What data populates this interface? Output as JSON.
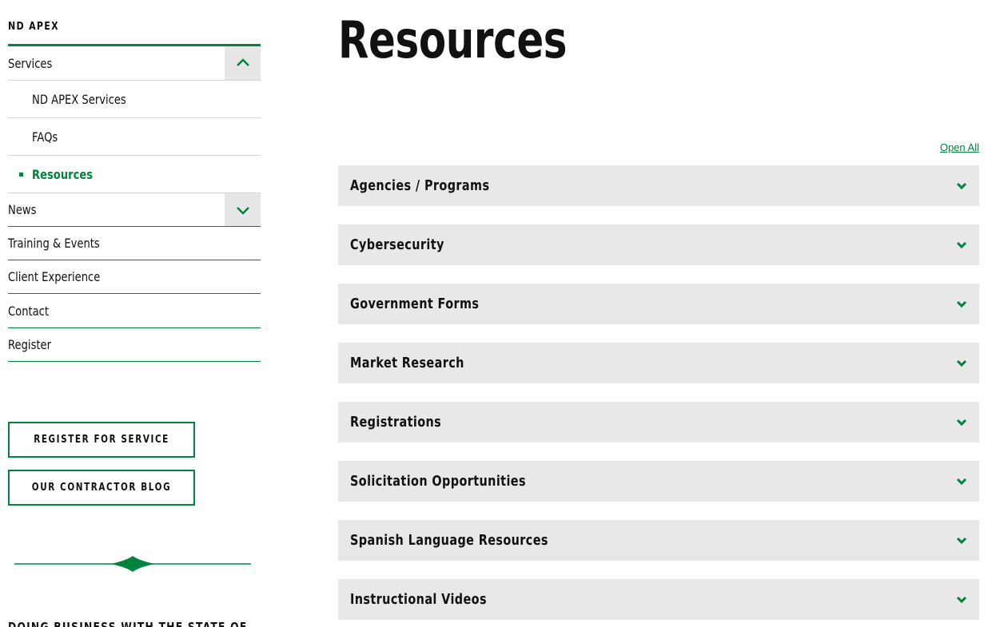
{
  "sidebar": {
    "brand": "ND APEX",
    "items": [
      {
        "label": "Services",
        "expanded": true
      },
      {
        "label": "ND APEX Services"
      },
      {
        "label": "FAQs"
      },
      {
        "label": "Resources",
        "active": true
      },
      {
        "label": "News",
        "expanded": false
      },
      {
        "label": "Training & Events"
      },
      {
        "label": "Client Experience"
      },
      {
        "label": "Contact"
      },
      {
        "label": "Register"
      }
    ],
    "cta": [
      {
        "label": "REGISTER FOR SERVICE"
      },
      {
        "label": "OUR CONTRACTOR BLOG"
      }
    ],
    "footer_cutoff_text": "DOING BUSINESS WITH THE STATE OF"
  },
  "main": {
    "title": "Resources",
    "open_all": "Open All",
    "accordions": [
      {
        "label": "Agencies / Programs"
      },
      {
        "label": "Cybersecurity"
      },
      {
        "label": "Government Forms"
      },
      {
        "label": "Market Research"
      },
      {
        "label": "Registrations"
      },
      {
        "label": "Solicitation Opportunities"
      },
      {
        "label": "Spanish Language Resources"
      },
      {
        "label": "Instructional Videos"
      }
    ]
  },
  "colors": {
    "accent": "#00843d",
    "panel": "#e8e8e8",
    "text": "#111111"
  },
  "icons": {
    "expanded": "chevron-up-icon",
    "collapsed": "chevron-down-icon"
  }
}
